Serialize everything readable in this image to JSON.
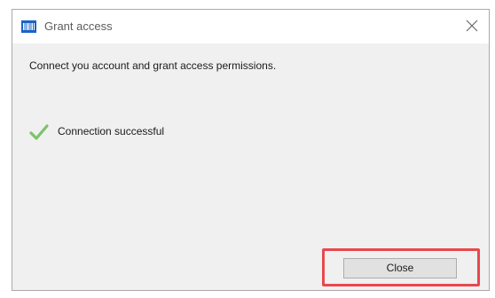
{
  "window": {
    "title": "Grant access",
    "app_icon": "barcode-icon",
    "close_icon": "close-icon"
  },
  "content": {
    "instruction": "Connect you account and grant access permissions.",
    "status": {
      "icon": "checkmark-icon",
      "text": "Connection successful",
      "icon_color": "#7cc36a"
    }
  },
  "footer": {
    "close_label": "Close",
    "highlight_color": "#e8484e"
  },
  "colors": {
    "accent": "#1a62c8",
    "dialog_background": "#f0f0f0"
  }
}
